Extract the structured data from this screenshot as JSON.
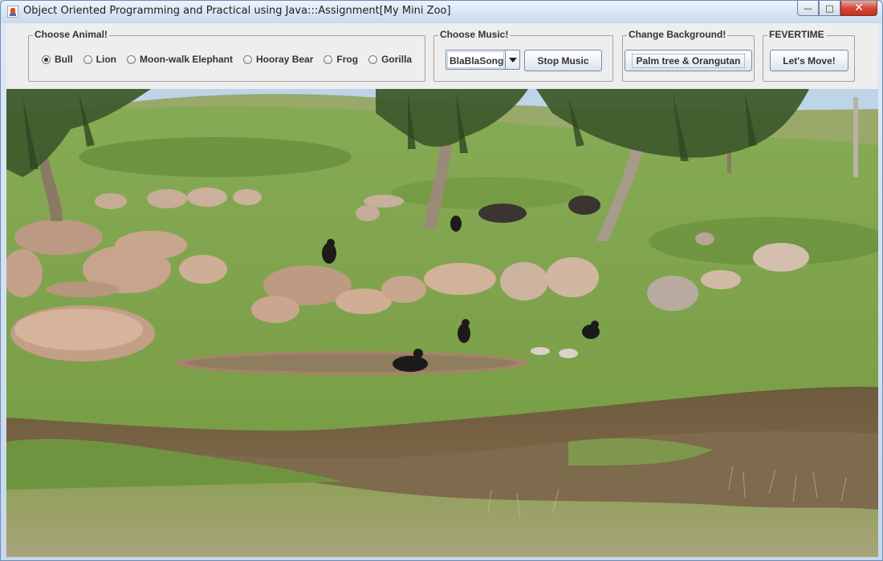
{
  "window": {
    "title": "Object Oriented Programming and Practical using Java:::Assignment[My Mini Zoo]",
    "buttons": {
      "minimize": "—",
      "maximize": "□",
      "close": "✕"
    }
  },
  "animal_group": {
    "title": "Choose Animal!",
    "options": [
      "Bull",
      "Lion",
      "Moon-walk Elephant",
      "Hooray Bear",
      "Frog",
      "Gorilla"
    ],
    "selected": "Bull"
  },
  "music_group": {
    "title": "Choose Music!",
    "selected_song": "BlaBlaSong",
    "stop_label": "Stop Music"
  },
  "background_group": {
    "title": "Change Background!",
    "button_label": "Palm tree & Orangutan"
  },
  "fever_group": {
    "title": "FEVERTIME",
    "button_label": "Let's Move!"
  },
  "scene": {
    "description_icon": "zoo-background-photo",
    "colors": {
      "sky": "#c7d9ea",
      "grass": "#7da24a",
      "grass_dark": "#5f8436",
      "rock": "#c9a48c",
      "dirt": "#7a5a3c"
    }
  }
}
